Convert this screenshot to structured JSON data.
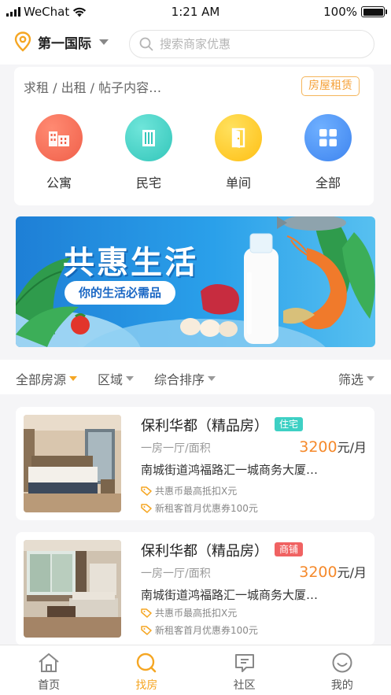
{
  "status_bar": {
    "carrier": "WeChat",
    "time": "1:21 AM",
    "battery": "100%",
    "battery_level": 1.0
  },
  "header": {
    "city": "第一国际",
    "search_placeholder": "搜索商家优惠"
  },
  "category_card": {
    "post_prompt": "求租 / 出租 / 帖子内容…",
    "rent_tag": "房屋租赁",
    "categories": [
      {
        "label": "公寓",
        "icon": "apartment-icon",
        "color": "#f0604a"
      },
      {
        "label": "民宅",
        "icon": "residence-icon",
        "color": "#3ed0c4"
      },
      {
        "label": "单间",
        "icon": "room-door-icon",
        "color": "#ffc623"
      },
      {
        "label": "全部",
        "icon": "grid-all-icon",
        "color": "#3e8df0"
      }
    ]
  },
  "banner": {
    "title": "共惠生活",
    "subtitle": "你的生活必需品"
  },
  "filters": {
    "all_sources": "全部房源",
    "region": "区域",
    "sort": "综合排序",
    "filter": "筛选"
  },
  "listings": [
    {
      "name": "保利华都（精品房）",
      "type_tag": "住宅",
      "tag_color": "#3ed0c4",
      "layout": "一房一厅/面积",
      "price": "3200",
      "price_unit": "元/月",
      "address": "南城街道鸿福路汇一城商务大厦…",
      "perk1": "共惠币最高抵扣X元",
      "perk2": "新租客首月优惠券100元"
    },
    {
      "name": "保利华都（精品房）",
      "type_tag": "商铺",
      "tag_color": "#f06262",
      "layout": "一房一厅/面积",
      "price": "3200",
      "price_unit": "元/月",
      "address": "南城街道鸿福路汇一城商务大厦…",
      "perk1": "共惠币最高抵扣X元",
      "perk2": "新租客首月优惠券100元"
    }
  ],
  "tabbar": {
    "tabs": [
      {
        "label": "首页",
        "icon": "home-icon"
      },
      {
        "label": "找房",
        "icon": "search-house-icon",
        "active": true
      },
      {
        "label": "社区",
        "icon": "community-icon"
      },
      {
        "label": "我的",
        "icon": "profile-icon"
      }
    ]
  },
  "colors": {
    "accent": "#f5a623",
    "price": "#f5892b",
    "banner_blue": "#2aa0ea"
  }
}
